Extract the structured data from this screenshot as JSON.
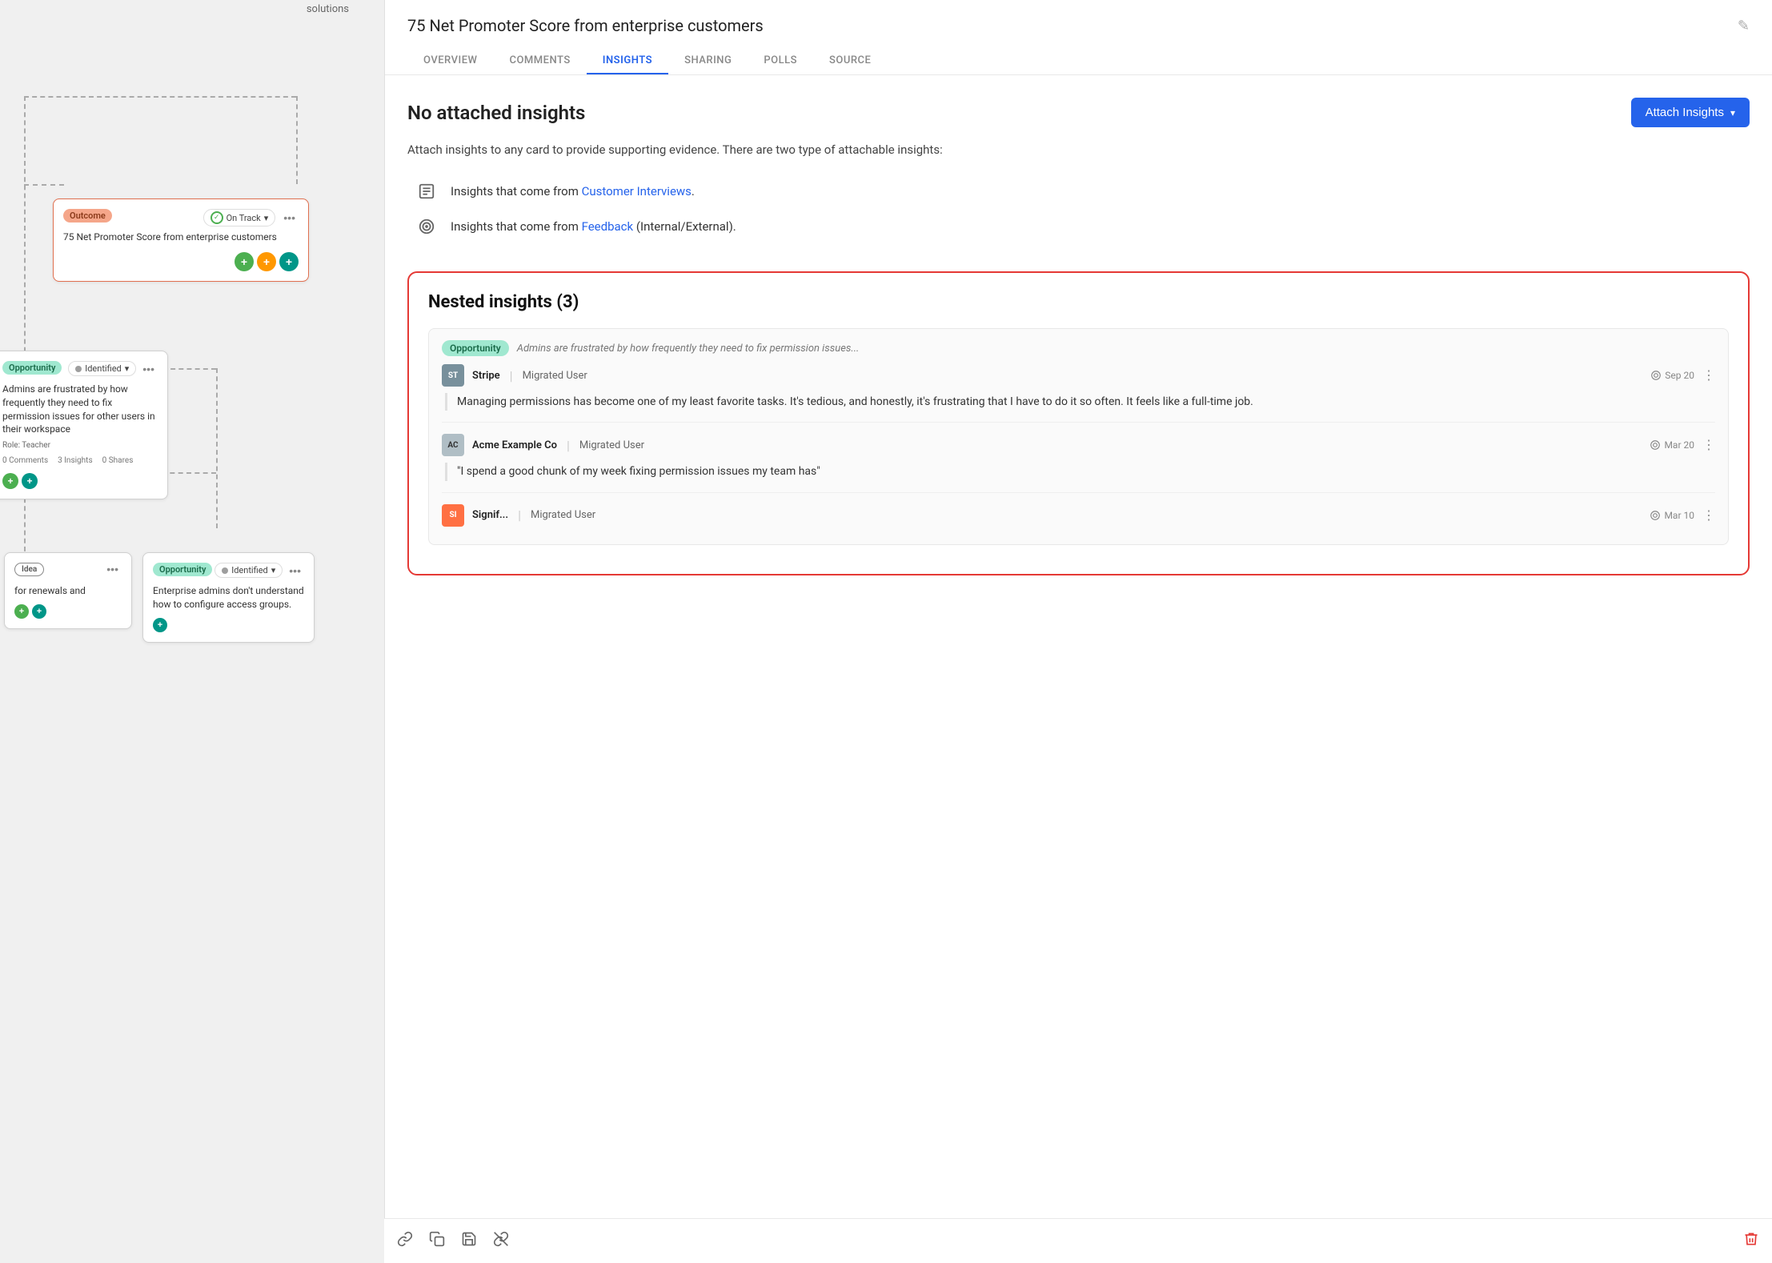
{
  "app": {
    "title": "75 Net Promoter Score from enterprise customers"
  },
  "left_panel": {
    "solutions_label": "solutions",
    "outcome_card": {
      "tag": "Outcome",
      "status": "On Track",
      "title": "75 Net Promoter Score from enterprise customers"
    },
    "opportunity_card_1": {
      "tag": "Opportunity",
      "status": "Identified",
      "title": "Admins are frustrated by how frequently they need to fix permission issues for other users in their workspace",
      "role": "Role: Teacher",
      "comments": "0 Comments",
      "insights": "3 Insights",
      "shares": "0 Shares"
    },
    "opportunity_card_2": {
      "tag": "Opportunity",
      "title": "Enterprise admins don't understand how to configure access groups."
    },
    "idea_card": {
      "tag": "Idea",
      "title": "for renewals and"
    }
  },
  "right_panel": {
    "title": "75 Net Promoter Score from enterprise customers",
    "tabs": [
      {
        "label": "OVERVIEW",
        "active": false
      },
      {
        "label": "COMMENTS",
        "active": false
      },
      {
        "label": "INSIGHTS",
        "active": true
      },
      {
        "label": "SHARING",
        "active": false
      },
      {
        "label": "POLLS",
        "active": false
      },
      {
        "label": "SOURCE",
        "active": false
      }
    ],
    "no_insights": {
      "title": "No attached insights",
      "attach_button": "Attach Insights",
      "description": "Attach insights to any card to provide supporting evidence. There are two type of attachable insights:",
      "types": [
        {
          "icon": "list-icon",
          "text_before": "Insights that come from ",
          "link": "Customer Interviews",
          "text_after": "."
        },
        {
          "icon": "feedback-icon",
          "text_before": "Insights that come from ",
          "link": "Feedback",
          "text_after": " (Internal/External)."
        }
      ]
    },
    "nested_insights": {
      "title": "Nested insights (3)",
      "items": [
        {
          "tag": "Opportunity",
          "subtitle": "Admins are frustrated by how frequently they need to fix permission issues...",
          "entries": [
            {
              "avatar_initials": "ST",
              "avatar_class": "st",
              "source": "Stripe",
              "user": "Migrated User",
              "date": "Sep 20",
              "quote": "Managing permissions has become one of my least favorite tasks. It's tedious, and honestly, it's frustrating that I have to do it so often. It feels like a full-time job."
            },
            {
              "avatar_initials": "AC",
              "avatar_class": "ac",
              "source": "Acme Example Co",
              "user": "Migrated User",
              "date": "Mar 20",
              "quote": "\"I spend a good chunk of my week fixing permission issues my team has\""
            },
            {
              "avatar_initials": "SI",
              "avatar_class": "or",
              "source": "Signif...",
              "user": "Migrated User",
              "date": "Mar 10",
              "quote": ""
            }
          ]
        }
      ]
    },
    "toolbar": {
      "link_icon": "link",
      "copy_icon": "copy",
      "save_icon": "save",
      "unlink_icon": "unlink",
      "delete_icon": "delete"
    }
  }
}
